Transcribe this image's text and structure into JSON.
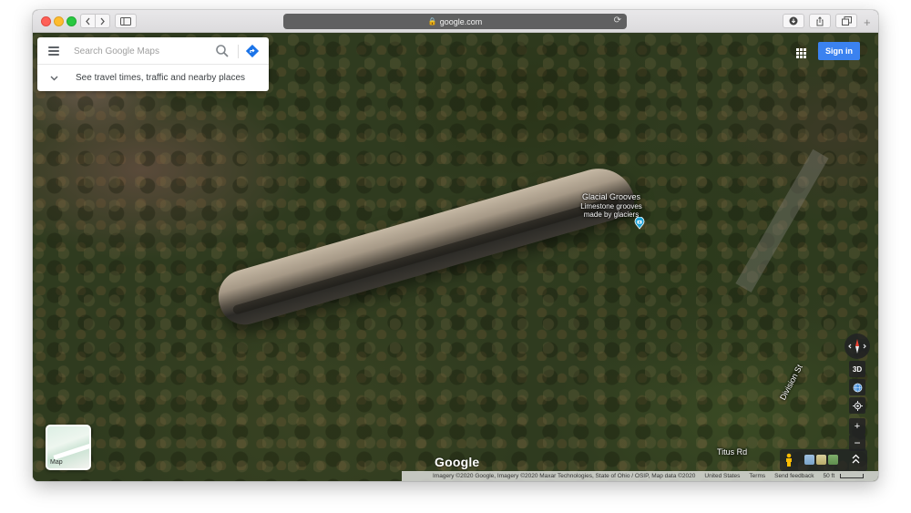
{
  "browser": {
    "url": "google.com",
    "lock_icon": "lock-icon"
  },
  "search": {
    "placeholder": "Search Google Maps",
    "expand_label": "See travel times, traffic and nearby places"
  },
  "header": {
    "signin_label": "Sign in"
  },
  "poi": {
    "title": "Glacial Grooves",
    "subtitle_line1": "Limestone grooves",
    "subtitle_line2": "made by glaciers"
  },
  "roads": {
    "division": "Division St",
    "titus": "Titus Rd"
  },
  "controls": {
    "three_d": "3D",
    "zoom_in": "+",
    "zoom_out": "−"
  },
  "layer": {
    "label": "Map"
  },
  "logo": {
    "text": "Google"
  },
  "attribution": {
    "imagery": "Imagery ©2020 Google, Imagery ©2020 Maxar Technologies, State of Ohio / OSIP, Map data ©2020",
    "region": "United States",
    "terms": "Terms",
    "feedback": "Send feedback",
    "scale": "50 ft"
  },
  "colors": {
    "signin_bg": "#3b82f0",
    "poi_pin": "#1fa3d6",
    "directions": "#1a73e8"
  }
}
